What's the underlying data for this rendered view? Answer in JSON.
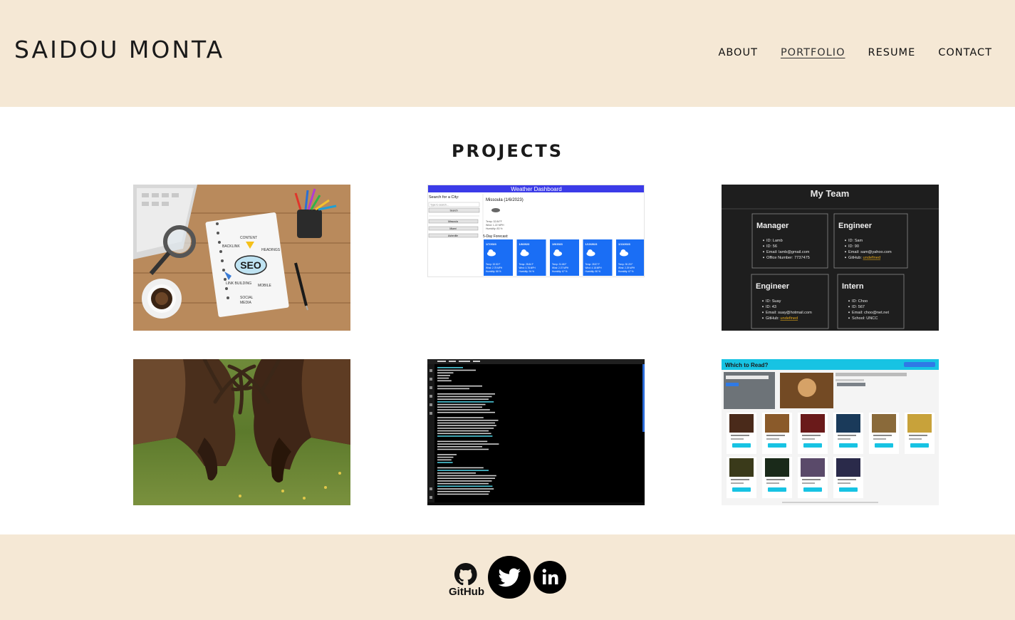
{
  "header": {
    "brand": "SAIDOU MONTA",
    "nav": [
      {
        "label": "ABOUT",
        "active": false
      },
      {
        "label": "PORTFOLIO",
        "active": true
      },
      {
        "label": "RESUME",
        "active": false
      },
      {
        "label": "CONTACT",
        "active": false
      }
    ]
  },
  "main": {
    "title": "PROJECTS",
    "projects": [
      {
        "image": "seo-notebook-desk-photo"
      },
      {
        "image": "weather-dashboard-screenshot",
        "header": "Weather Dashboard",
        "search_label": "Search for a City:",
        "search_placeholder": "Type to search...",
        "search_button": "Search",
        "history": [
          "Missoula",
          "Miami",
          "Asheville"
        ],
        "current_city": "Missoula (1/6/2023)",
        "current_stats": [
          "Temp: 32.84°F",
          "Wind: 1.22 MPH",
          "Humidity: 83 %"
        ],
        "forecast_label": "5-Day Forecast:",
        "forecast": [
          {
            "date": "1/7/2023",
            "temp": "Temp: 32.52 F",
            "wind": "Wind: 2.75 MPH",
            "humidity": "Humidity: 86 %"
          },
          {
            "date": "1/8/2023",
            "temp": "Temp: 28.84 F",
            "wind": "Wind: 3.78 MPH",
            "humidity": "Humidity: 94 %"
          },
          {
            "date": "1/9/2023",
            "temp": "Temp: 31.68 F",
            "wind": "Wind: 2.37 MPH",
            "humidity": "Humidity: 67 %"
          },
          {
            "date": "1/10/2023",
            "temp": "Temp: 28.57 F",
            "wind": "Wind: 4.18 MPH",
            "humidity": "Humidity: 80 %"
          },
          {
            "date": "1/11/2023",
            "temp": "Temp: 30.25 F",
            "wind": "Wind: 2.29 MPH",
            "humidity": "Humidity: 67 %"
          }
        ]
      },
      {
        "image": "my-team-screenshot",
        "title": "My Team",
        "members": [
          {
            "role": "Manager",
            "lines": [
              "ID: Lamb",
              "ID: 56",
              "Email: lamb@gmail.com",
              "Office Number: 7737475"
            ]
          },
          {
            "role": "Engineer",
            "lines": [
              "ID: Sam",
              "ID: 90",
              "Email: sam@yahoo.com",
              "GitHub: "
            ],
            "link": "undefined"
          },
          {
            "role": "Engineer",
            "lines": [
              "ID: Suay",
              "ID: 43",
              "Email: suay@hotmail.com",
              "GitHub: "
            ],
            "link": "undefined"
          },
          {
            "role": "Intern",
            "lines": [
              "ID: Choo",
              "ID: 567",
              "Email: choo@net.net",
              "School: UNCC"
            ]
          }
        ]
      },
      {
        "image": "elk-sparring-photo"
      },
      {
        "image": "terminal-cli-screenshot"
      },
      {
        "image": "which-to-read-book-app-screenshot",
        "header": "Which to Read?"
      }
    ]
  },
  "footer": {
    "github_label": "GitHub",
    "icons": [
      "github-icon",
      "twitter-icon",
      "linkedin-icon"
    ]
  },
  "colors": {
    "header_bg": "#f5e8d5",
    "footer_bg": "#f5e8d5",
    "weather_blue": "#1a6ef5",
    "weather_header": "#3b3be8",
    "team_bg": "#1e1e1e",
    "book_app_cyan": "#17c3e3"
  }
}
